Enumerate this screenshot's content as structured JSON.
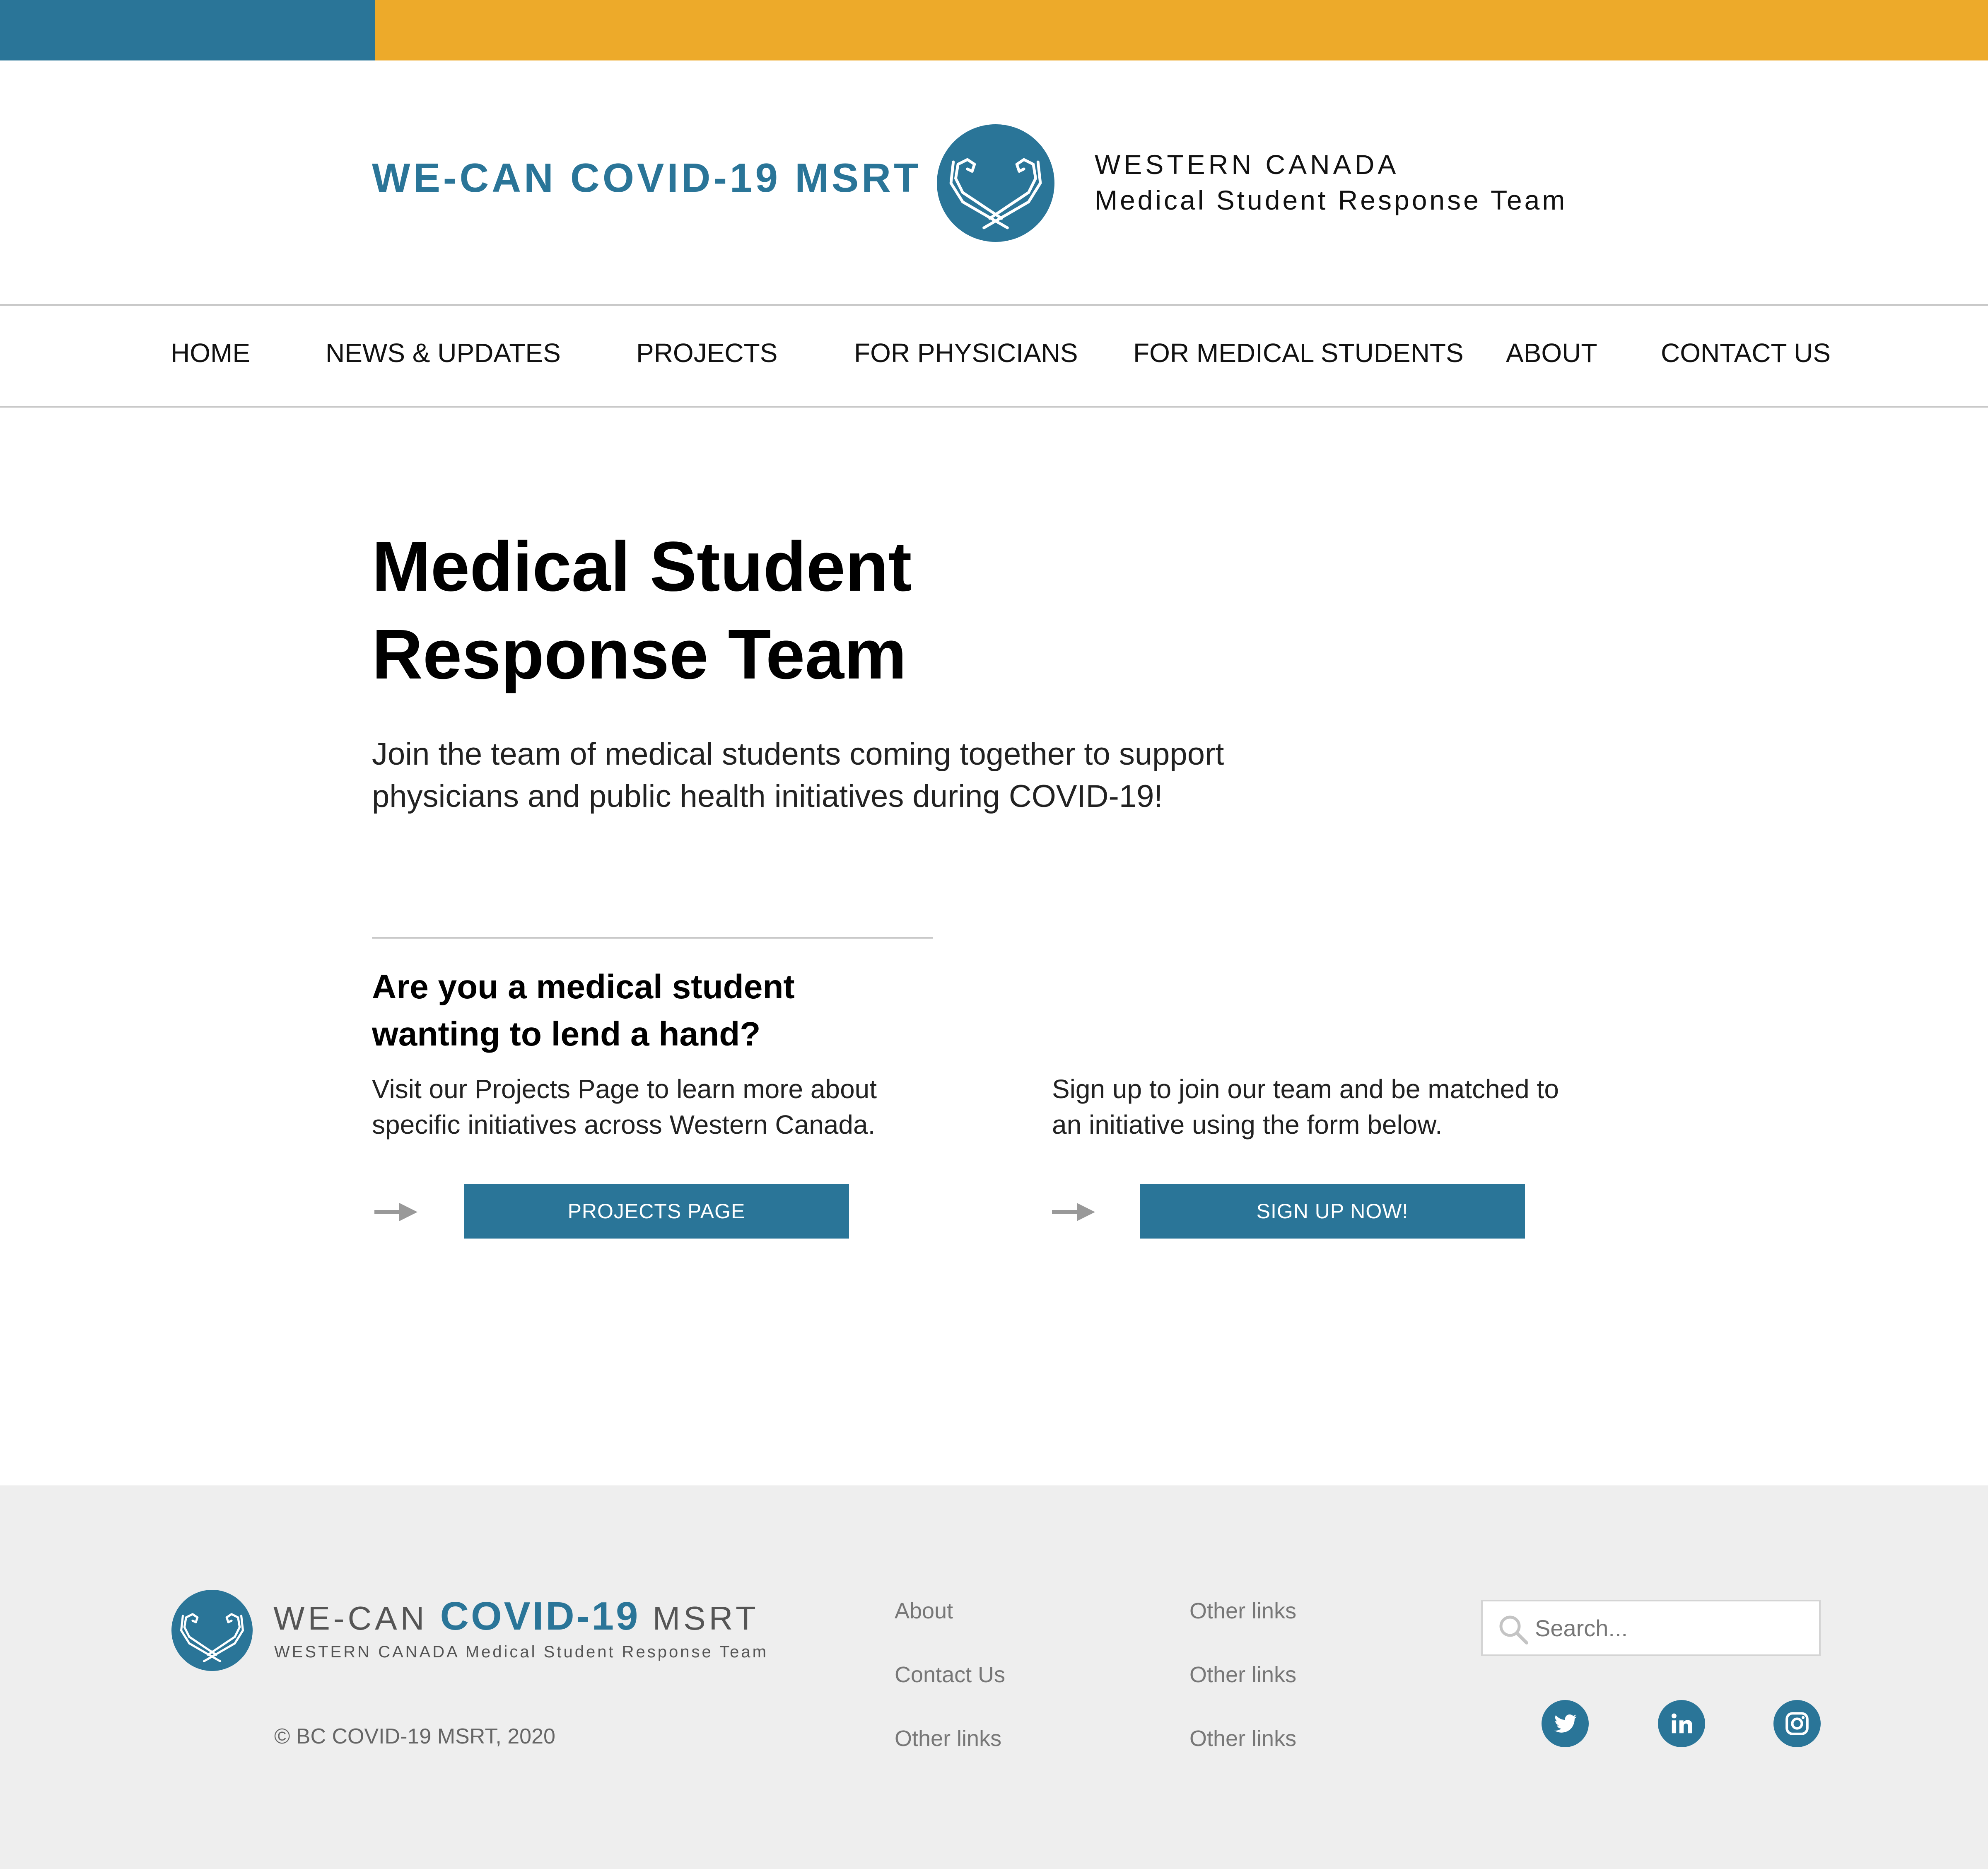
{
  "header": {
    "title": "WE-CAN COVID-19 MSRT",
    "tagline_line1": "WESTERN CANADA",
    "tagline_line2": "Medical Student Response Team",
    "logo_icon": "crossed-arms-logo-icon"
  },
  "nav": {
    "items": [
      {
        "label": "HOME"
      },
      {
        "label": "NEWS & UPDATES"
      },
      {
        "label": "PROJECTS"
      },
      {
        "label": "FOR PHYSICIANS"
      },
      {
        "label": "FOR MEDICAL STUDENTS"
      },
      {
        "label": "ABOUT"
      },
      {
        "label": "CONTACT US"
      }
    ]
  },
  "hero": {
    "title_line1": "Medical Student",
    "title_line2": "Response Team",
    "subtitle_line1": "Join the team of medical students coming together to support",
    "subtitle_line2": "physicians and public health initiatives during COVID-19!"
  },
  "cta_section": {
    "question_line1": "Are you a medical student",
    "question_line2": "wanting to lend a hand?",
    "left": {
      "text_line1": "Visit our Projects Page to learn more about",
      "text_line2": "specific initiatives across Western Canada.",
      "button_label": "PROJECTS PAGE",
      "arrow_icon": "arrow-right-icon"
    },
    "right": {
      "text_line1": "Sign up to join our team and be matched to",
      "text_line2": "an initiative using the form below.",
      "button_label": "SIGN UP NOW!",
      "arrow_icon": "arrow-right-icon"
    }
  },
  "footer": {
    "brand_part1": "WE-CAN ",
    "brand_part2": "COVID-19",
    "brand_part3": " MSRT",
    "brand_sub": "WESTERN CANADA Medical Student Response Team",
    "copyright": "© BC COVID-19 MSRT, 2020",
    "links_col1": [
      "About",
      "Contact Us",
      "Other links"
    ],
    "links_col2": [
      "Other links",
      "Other links",
      "Other links"
    ],
    "search": {
      "placeholder": "Search...",
      "value": ""
    },
    "social": [
      "twitter-icon",
      "linkedin-icon",
      "instagram-icon"
    ]
  },
  "colors": {
    "brand_blue": "#2a7598",
    "accent_yellow": "#edaa2a",
    "footer_bg": "#eeeeee"
  }
}
